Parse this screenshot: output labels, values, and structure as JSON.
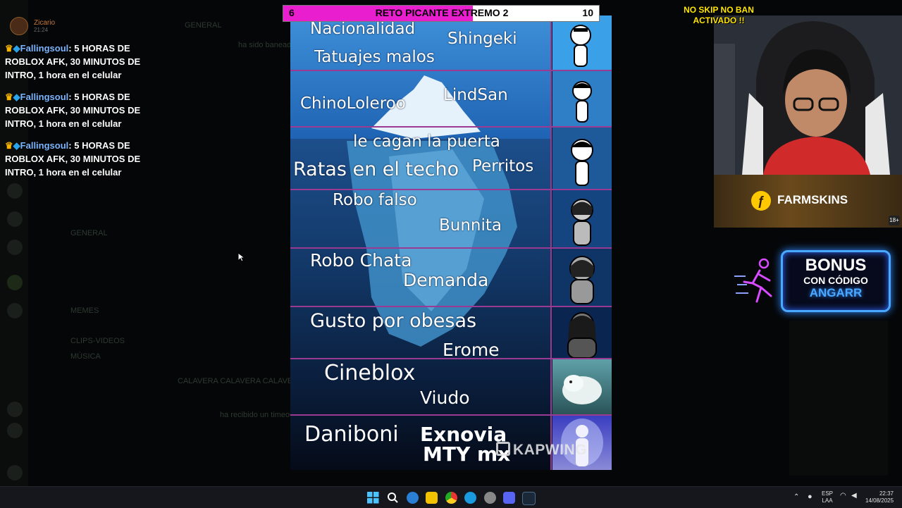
{
  "chat": {
    "user_name": "Zicario",
    "user_time": "21:24",
    "messages": [
      {
        "crown": "♛",
        "gem": "◆",
        "user": "Fallingsoul",
        "text": ": 5 HORAS DE ROBLOX AFK, 30 MINUTOS DE INTRO, 1 hora en el celular"
      },
      {
        "crown": "♛",
        "gem": "◆",
        "user": "Fallingsoul",
        "text": ": 5 HORAS DE ROBLOX AFK, 30 MINUTOS DE INTRO, 1 hora en el celular"
      },
      {
        "crown": "♛",
        "gem": "◆",
        "user": "Fallingsoul",
        "text": ": 5 HORAS DE ROBLOX AFK, 30 MINUTOS DE INTRO, 1 hora en el celular"
      }
    ]
  },
  "title_bar": {
    "left_number": "6",
    "title": "RETO PICANTE EXTREMO 2",
    "right_number": "10",
    "progress_fraction": 0.6,
    "fill_color": "#e81ecf"
  },
  "iceberg": {
    "tiers": [
      {
        "labels": [
          "Nacionalidad",
          "Shingeki",
          "Tatuajes malos"
        ]
      },
      {
        "labels": [
          "ChinoLoleroo",
          "LindSan"
        ]
      },
      {
        "labels": [
          "le cagan la puerta",
          "Ratas en el techo",
          "Perritos"
        ]
      },
      {
        "labels": [
          "Robo falso",
          "Bunnita"
        ]
      },
      {
        "labels": [
          "Robo Chata",
          "Demanda"
        ]
      },
      {
        "labels": [
          "Gusto por obesas",
          "Erome"
        ]
      },
      {
        "labels": [
          "Cineblox",
          "Viudo"
        ]
      },
      {
        "labels": [
          "Daniboni",
          "Exnovia",
          "MTY mx"
        ]
      }
    ],
    "separator_color": "#9b3a92"
  },
  "overlay": {
    "no_skip_line1": "NO SKIP NO BAN",
    "no_skip_line2": "ACTIVADO !!",
    "farmskins_label": "FARMSKINS",
    "farmskins_age": "18+",
    "bonus_title": "BONUS",
    "bonus_subtitle": "CON CÓDIGO",
    "bonus_code": "ANGARR",
    "watermark": "KAPWING"
  },
  "background_discord": {
    "items": [
      "GENERAL",
      "MEMES",
      "CLIPS-VIDEOS",
      "MÚSICA",
      "GENERAL",
      "CALAVERA CALAVERA CALAVERA",
      "ha sido baneado",
      "ha recibido un timeout"
    ]
  },
  "taskbar": {
    "lang_line1": "ESP",
    "lang_line2": "LAA",
    "time": "22:37",
    "date": "14/08/2025"
  }
}
